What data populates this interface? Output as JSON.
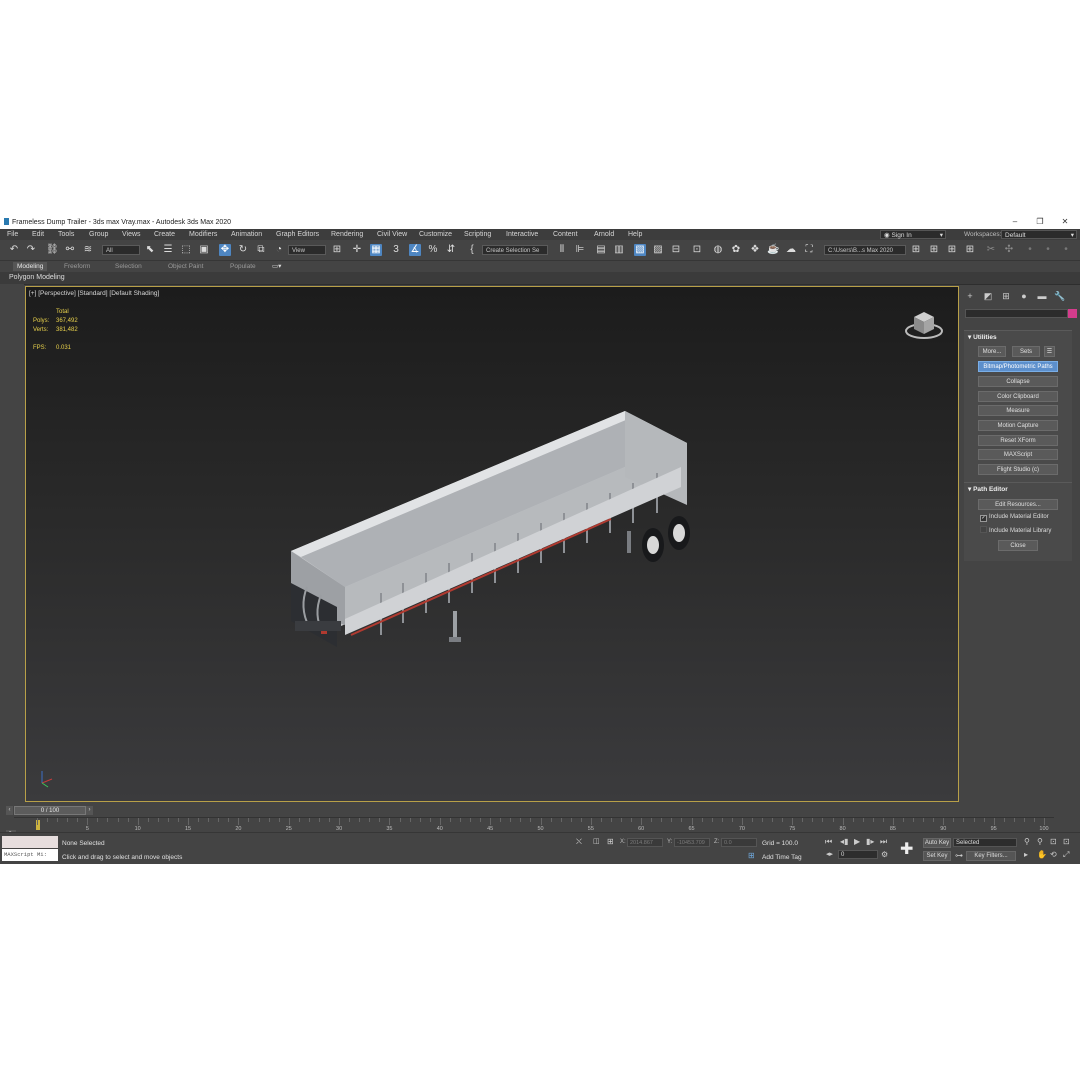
{
  "window": {
    "title": "Frameless Dump Trailer - 3ds max Vray.max - Autodesk 3ds Max 2020",
    "minimize": "–",
    "restore": "❐",
    "close": "✕"
  },
  "menu": [
    "File",
    "Edit",
    "Tools",
    "Group",
    "Views",
    "Create",
    "Modifiers",
    "Animation",
    "Graph Editors",
    "Rendering",
    "Civil View",
    "Customize",
    "Scripting",
    "Interactive",
    "Content",
    "Arnold",
    "Help"
  ],
  "account": {
    "sign_in": "Sign In"
  },
  "workspace": {
    "label": "Workspaces:",
    "value": "Default"
  },
  "toolbar": {
    "selection_filter": "All",
    "ref_coord": "View",
    "named_selection": "Create Selection Se",
    "project_path": "C:\\Users\\B...s Max 2020"
  },
  "ribbon": {
    "tabs": [
      "Modeling",
      "Freeform",
      "Selection",
      "Object Paint",
      "Populate"
    ],
    "selected_tab": "Modeling",
    "sub_label": "Polygon Modeling"
  },
  "viewport": {
    "label": "[+] [Perspective] [Standard] [Default Shading]",
    "stats": {
      "total_label": "Total",
      "polys_label": "Polys:",
      "polys_value": "367,492",
      "verts_label": "Verts:",
      "verts_value": "381,482",
      "fps_label": "FPS:",
      "fps_value": "0.031"
    }
  },
  "command_panel": {
    "utilities": {
      "title": "Utilities",
      "more": "More...",
      "sets": "Sets",
      "buttons": [
        "Bitmap/Photometric Paths",
        "Collapse",
        "Color Clipboard",
        "Measure",
        "Motion Capture",
        "Reset XForm",
        "MAXScript",
        "Flight Studio (c)"
      ],
      "highlighted": "Bitmap/Photometric Paths"
    },
    "path_editor": {
      "title": "Path Editor",
      "edit_resources": "Edit Resources...",
      "include_material_editor": "Include Material Editor",
      "include_material_library": "Include Material Library",
      "close": "Close"
    }
  },
  "timeline": {
    "slider": "0 / 100",
    "ticks": [
      "5",
      "10",
      "15",
      "20",
      "25",
      "30",
      "35",
      "40",
      "45",
      "50",
      "55",
      "60",
      "65",
      "70",
      "75",
      "80",
      "85",
      "90",
      "95",
      "100"
    ]
  },
  "status": {
    "maxscript_label": "MAXScript Mi:",
    "selection": "None Selected",
    "prompt": "Click and drag to select and move objects",
    "x_label": "X:",
    "x_value": "2014.867",
    "y_label": "Y:",
    "y_value": "-10453.709",
    "z_label": "Z:",
    "z_value": "0.0",
    "grid": "Grid = 100.0",
    "add_time_tag": "Add Time Tag",
    "frame_field": "0",
    "auto_key": "Auto Key",
    "selected_dd": "Selected",
    "set_key": "Set Key",
    "key_filters": "Key Filters..."
  }
}
